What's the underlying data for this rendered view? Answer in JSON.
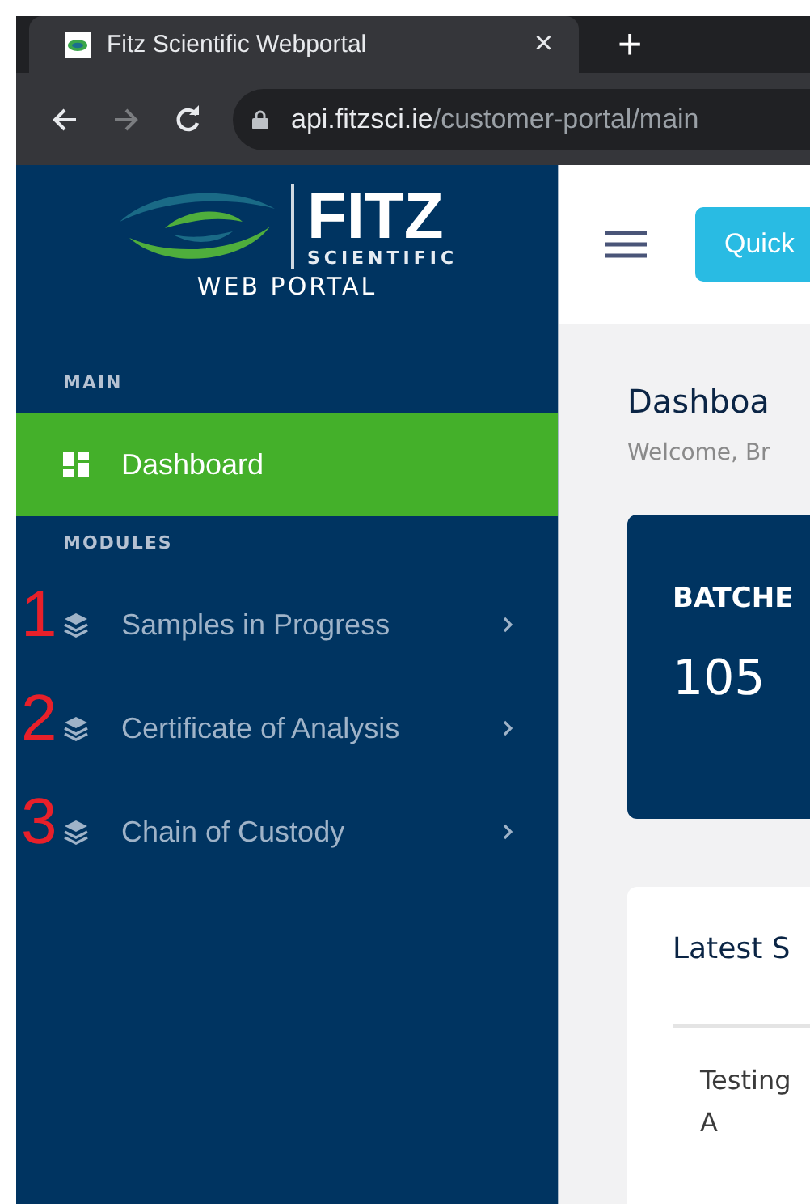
{
  "browser": {
    "tab": {
      "title": "Fitz Scientific Webportal",
      "close": "×"
    },
    "new_tab": "+",
    "nav": {
      "back_disabled": false,
      "forward_disabled": true
    },
    "url": {
      "host": "api.fitzsci.ie",
      "path": "/customer-portal/main"
    }
  },
  "sidebar": {
    "logo": {
      "brand": "FITZ",
      "sub": "SCIENTIFIC",
      "tagline": "WEB PORTAL"
    },
    "sections": [
      {
        "heading": "MAIN",
        "items": [
          {
            "label": "Dashboard",
            "kind": "dashboard",
            "selected": true
          }
        ]
      },
      {
        "heading": "MODULES",
        "items": [
          {
            "label": "Samples in Progress",
            "kind": "module",
            "selected": false,
            "marker": "1"
          },
          {
            "label": "Certificate of Analysis",
            "kind": "module",
            "selected": false,
            "marker": "2"
          },
          {
            "label": "Chain of Custody",
            "kind": "module",
            "selected": false,
            "marker": "3"
          }
        ]
      }
    ]
  },
  "header": {
    "button": "Quick"
  },
  "page": {
    "title": "Dashboa",
    "subtitle": "Welcome, Br"
  },
  "stat_card": {
    "label": "BATCHE",
    "value": "105"
  },
  "latest_card": {
    "title": "Latest S",
    "cell": [
      "Testing",
      "A"
    ]
  }
}
